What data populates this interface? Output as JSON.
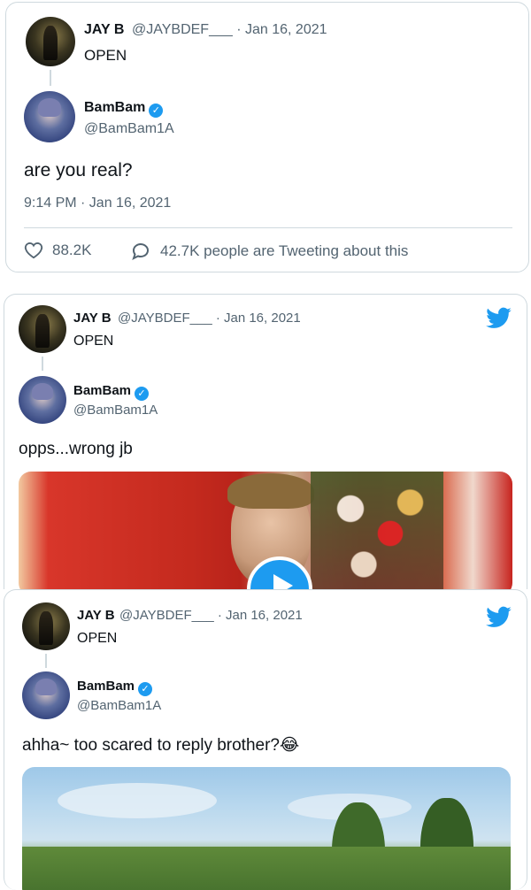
{
  "cards": [
    {
      "parent": {
        "name": "JAY B",
        "handle": "@JAYBDEF___",
        "date": "· Jan 16, 2021",
        "text": "OPEN"
      },
      "reply": {
        "name": "BamBam",
        "handle": "@BamBam1A",
        "text": "are you real?"
      },
      "timestamp": "9:14 PM · Jan 16, 2021",
      "likes": "88.2K",
      "tweeting": "42.7K people are Tweeting about this"
    },
    {
      "parent": {
        "name": "JAY B",
        "handle": "@JAYBDEF___",
        "date": "· Jan 16, 2021",
        "text": "OPEN"
      },
      "reply": {
        "name": "BamBam",
        "handle": "@BamBam1A",
        "text": "opps...wrong jb"
      }
    },
    {
      "parent": {
        "name": "JAY B",
        "handle": "@JAYBDEF___",
        "date": "· Jan 16, 2021",
        "text": "OPEN"
      },
      "reply": {
        "name": "BamBam",
        "handle": "@BamBam1A",
        "text": "ahha~ too scared to reply brother?😂"
      }
    }
  ],
  "icons": {
    "verified": "verified-badge-icon",
    "twitter": "twitter-bird-icon",
    "heart": "heart-icon",
    "reply": "comment-icon",
    "play": "play-icon"
  },
  "colors": {
    "twitter_blue": "#1d9bf0",
    "muted": "#536471",
    "border": "#cfd9de"
  }
}
